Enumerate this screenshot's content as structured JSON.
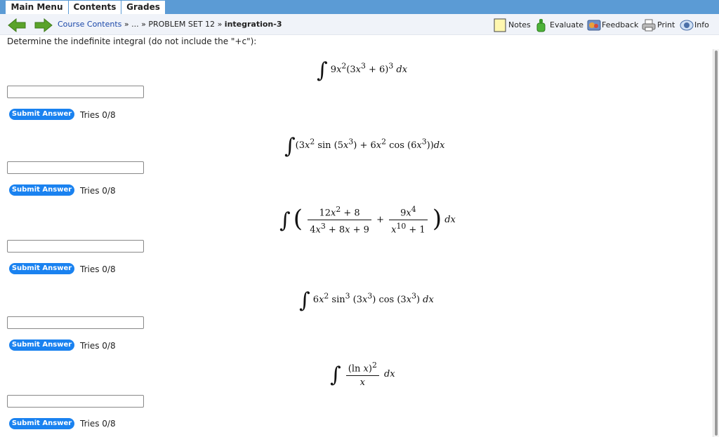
{
  "menu": {
    "items": [
      "Main Menu",
      "Contents",
      "Grades"
    ]
  },
  "breadcrumb": {
    "course_contents": "Course Contents",
    "sep1": "»",
    "ellipsis": "...",
    "sep2": "»",
    "problem_set": "PROBLEM SET 12",
    "sep3": "»",
    "current": "integration-3"
  },
  "tools": {
    "notes": "Notes",
    "evaluate": "Evaluate",
    "feedback": "Feedback",
    "print": "Print",
    "info": "Info"
  },
  "instructions": "Determine the indefinite integral (do not include the \"+c\"):",
  "problems": [
    {
      "tries": "Tries 0/8",
      "submit": "Submit Answer",
      "answer": ""
    },
    {
      "tries": "Tries 0/8",
      "submit": "Submit Answer",
      "answer": ""
    },
    {
      "tries": "Tries 0/8",
      "submit": "Submit Answer",
      "answer": ""
    },
    {
      "tries": "Tries 0/8",
      "submit": "Submit Answer",
      "answer": ""
    },
    {
      "tries": "Tries 0/8",
      "submit": "Submit Answer",
      "answer": ""
    }
  ],
  "formulas": {
    "f1": {
      "int": "∫",
      "body_a": "9",
      "x1": "x",
      "e1": "2",
      "body_b": "(3",
      "x2": "x",
      "e2": "3",
      "body_c": " + 6)",
      "e3": "3",
      "dx": "dx"
    },
    "f2": {
      "int": "∫",
      "a": "(3",
      "x1": "x",
      "e1": "2",
      "b": " sin (5",
      "x2": "x",
      "e2": "3",
      "c": ") + 6",
      "x3": "x",
      "e3": "2",
      "d": " cos (6",
      "x4": "x",
      "e4": "3",
      "e": "))",
      "dx": "dx"
    },
    "f3": {
      "int": "∫",
      "lp": "(",
      "n1a": "12",
      "n1x": "x",
      "n1e": "2",
      "n1b": " + 8",
      "d1a": "4",
      "d1x": "x",
      "d1e": "3",
      "d1b": " + 8",
      "d1x2": "x",
      "d1c": " + 9",
      "plus": "+",
      "n2a": "9",
      "n2x": "x",
      "n2e": "4",
      "d2x": "x",
      "d2e": "10",
      "d2b": " + 1",
      "rp": ")",
      "dx": "dx"
    },
    "f4": {
      "int": "∫",
      "a": "6",
      "x1": "x",
      "e1": "2",
      "b": " sin",
      "e2": "3",
      "c": " (3",
      "x2": "x",
      "e3": "3",
      "d": ") cos (3",
      "x3": "x",
      "e4": "3",
      "e": ")",
      "dx": "dx"
    },
    "f5": {
      "int": "∫",
      "num": "(ln ",
      "nx": "x",
      "nb": ")",
      "ne": "2",
      "den": "x",
      "dx": "dx"
    }
  },
  "colors": {
    "menu_bar": "#5b9bd5",
    "submit": "#1a82f0",
    "nav_arrow": "#5aa32a",
    "link": "#1a47a8"
  }
}
